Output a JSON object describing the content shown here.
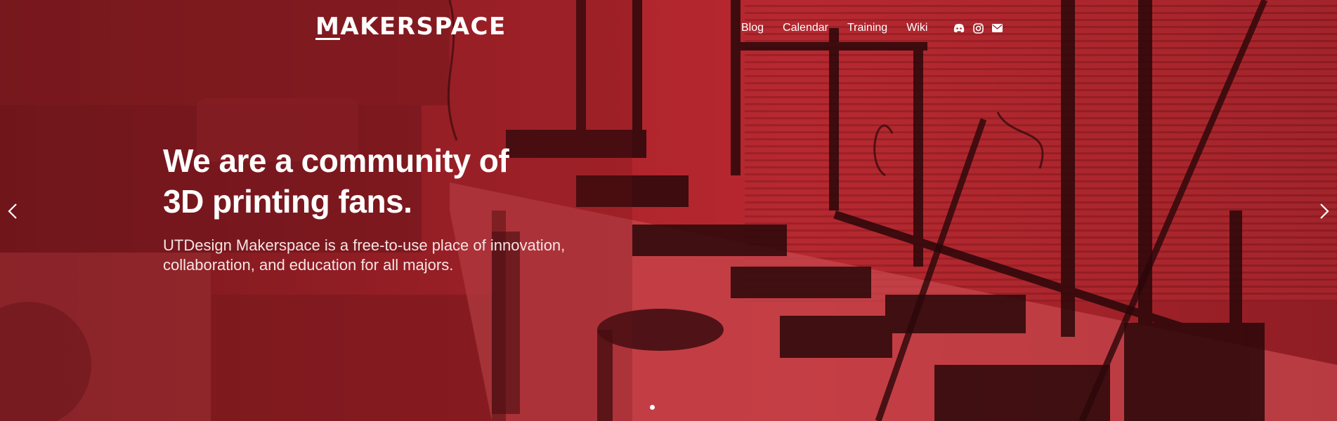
{
  "brand": {
    "logo_text": "MAKERSPACE",
    "logo_first_letter": "M",
    "logo_rest": "AKERSPACE"
  },
  "nav": {
    "links": [
      {
        "label": "Blog"
      },
      {
        "label": "Calendar"
      },
      {
        "label": "Training"
      },
      {
        "label": "Wiki"
      }
    ],
    "icons": [
      "discord-icon",
      "instagram-icon",
      "email-icon"
    ]
  },
  "hero": {
    "headline_line1": "We are a community of",
    "headline_line2": "3D printing fans.",
    "subtext_line1": "UTDesign Makerspace is a free-to-use place of innovation,",
    "subtext_line2": "collaboration, and education for all majors."
  },
  "carousel": {
    "prev_icon": "chevron-left-icon",
    "next_icon": "chevron-right-icon",
    "slide_count": 1,
    "active_slide": 1
  },
  "colors": {
    "overlay_red": "#b5242c",
    "overlay_dark": "#5c1216",
    "text": "#ffffff"
  }
}
